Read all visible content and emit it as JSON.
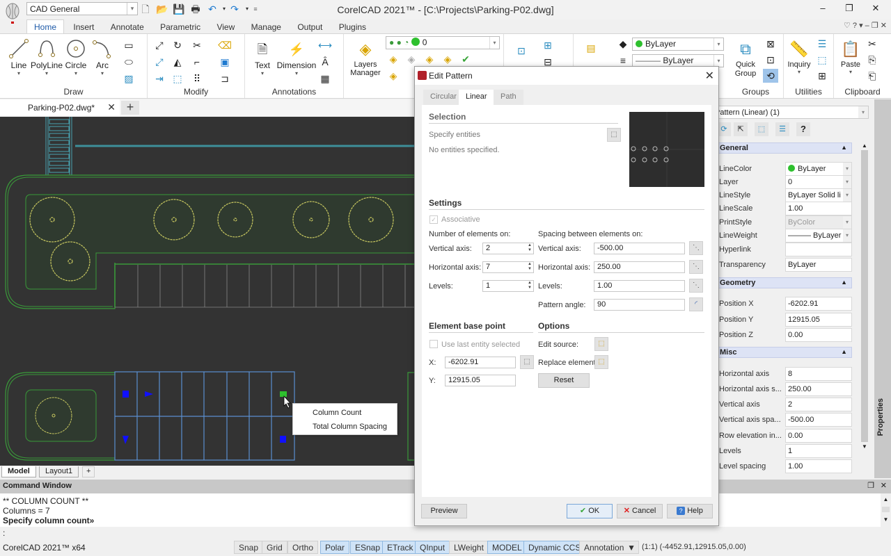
{
  "app": {
    "title": "CorelCAD 2021™ - [C:\\Projects\\Parking-P02.dwg]",
    "workspace": "CAD General",
    "window_controls": {
      "minimize": "‒",
      "restore": "❐",
      "close": "✕"
    },
    "mdi_controls": "♡  ?  ▾  ‒  ❐  ✕"
  },
  "quick_access": [
    {
      "name": "new-file-icon",
      "glyph": "🗋"
    },
    {
      "name": "open-folder-icon",
      "glyph": "📂"
    },
    {
      "name": "save-icon",
      "glyph": "💾"
    },
    {
      "name": "print-icon",
      "glyph": "🖶"
    },
    {
      "name": "undo-icon",
      "glyph": "↶"
    },
    {
      "name": "redo-icon",
      "glyph": "↷"
    }
  ],
  "ribbon_tabs": [
    "Home",
    "Insert",
    "Annotate",
    "Parametric",
    "View",
    "Manage",
    "Output",
    "Plugins"
  ],
  "ribbon": {
    "draw": {
      "label": "Draw",
      "buttons": [
        "Line",
        "PolyLine",
        "Circle",
        "Arc"
      ]
    },
    "modify": {
      "label": "Modify"
    },
    "annotations": {
      "label": "Annotations",
      "buttons": [
        "Text",
        "Dimension"
      ]
    },
    "layers": {
      "button": "Layers Manager",
      "layer_value": "0"
    },
    "properties": {
      "color": "ByLayer",
      "linestyle": "ByLayer"
    },
    "groups": {
      "label": "Groups",
      "button": "Quick Group"
    },
    "utilities": {
      "label": "Utilities",
      "button": "Inquiry"
    },
    "clipboard": {
      "label": "Clipboard",
      "button": "Paste"
    }
  },
  "document_tab": {
    "label": "Parking-P02.dwg*",
    "close": "✕",
    "new": "+"
  },
  "layout_tabs": [
    "Model",
    "Layout1",
    "+"
  ],
  "context_menu": [
    "Column Count",
    "Total Column Spacing"
  ],
  "command_window": {
    "title": "Command Window",
    "lines": [
      "** COLUMN COUNT **",
      "Columns = 7",
      "Specify column count»"
    ],
    "prompt": ":"
  },
  "status_bar": {
    "app": "CorelCAD 2021™ x64",
    "toggles": [
      {
        "label": "Snap",
        "on": false
      },
      {
        "label": "Grid",
        "on": false
      },
      {
        "label": "Ortho",
        "on": false
      },
      {
        "label": "Polar",
        "on": true
      },
      {
        "label": "ESnap",
        "on": true
      },
      {
        "label": "ETrack",
        "on": true
      },
      {
        "label": "QInput",
        "on": true
      },
      {
        "label": "LWeight",
        "on": false
      },
      {
        "label": "MODEL",
        "on": true
      },
      {
        "label": "Dynamic CCS",
        "on": true
      }
    ],
    "annotation": "Annotation",
    "coords": "(1:1)  (-4452.91,12915.05,0.00)"
  },
  "properties_panel": {
    "selector": "Pattern (Linear) (1)",
    "side_label": "Properties",
    "categories": [
      {
        "name": "General",
        "rows": [
          {
            "label": "LineColor",
            "value": "ByLayer",
            "dropdown": true,
            "dot": true
          },
          {
            "label": "Layer",
            "value": "0",
            "dropdown": true
          },
          {
            "label": "LineStyle",
            "value": "ByLayer    Solid li",
            "dropdown": true
          },
          {
            "label": "LineScale",
            "value": "1.00"
          },
          {
            "label": "PrintStyle",
            "value": "ByColor",
            "dropdown": true,
            "disabled": true
          },
          {
            "label": "LineWeight",
            "value": "——— ByLayer",
            "dropdown": true
          },
          {
            "label": "Hyperlink",
            "value": ""
          },
          {
            "label": "Transparency",
            "value": "ByLayer"
          }
        ]
      },
      {
        "name": "Geometry",
        "rows": [
          {
            "label": "Position X",
            "value": "-6202.91"
          },
          {
            "label": "Position Y",
            "value": "12915.05"
          },
          {
            "label": "Position Z",
            "value": "0.00"
          }
        ]
      },
      {
        "name": "Misc",
        "rows": [
          {
            "label": "Horizontal axis",
            "value": "8"
          },
          {
            "label": "Horizontal axis s...",
            "value": "250.00"
          },
          {
            "label": "Vertical axis",
            "value": "2"
          },
          {
            "label": "Vertical axis spa...",
            "value": "-500.00"
          },
          {
            "label": "Row elevation in...",
            "value": "0.00"
          },
          {
            "label": "Levels",
            "value": "1"
          },
          {
            "label": "Level spacing",
            "value": "1.00"
          }
        ]
      }
    ]
  },
  "dialog": {
    "title": "Edit Pattern",
    "tabs": [
      "Circular",
      "Linear",
      "Path"
    ],
    "active_tab": "Linear",
    "selection": {
      "heading": "Selection",
      "specify": "Specify entities",
      "status": "No entities specified."
    },
    "settings": {
      "heading": "Settings",
      "associative": "Associative",
      "number_heading": "Number of elements on:",
      "spacing_heading": "Spacing between elements on:",
      "vertical_label": "Vertical axis:",
      "horizontal_label": "Horizontal axis:",
      "levels_label": "Levels:",
      "angle_label": "Pattern angle:",
      "num_vertical": "2",
      "num_horizontal": "7",
      "num_levels": "1",
      "sp_vertical": "-500.00",
      "sp_horizontal": "250.00",
      "sp_levels": "1.00",
      "angle": "90"
    },
    "base_point": {
      "heading": "Element base point",
      "use_last": "Use last entity selected",
      "x_label": "X:",
      "y_label": "Y:",
      "x": "-6202.91",
      "y": "12915.05"
    },
    "options": {
      "heading": "Options",
      "edit_source": "Edit source:",
      "replace": "Replace element:",
      "reset": "Reset"
    },
    "buttons": {
      "preview": "Preview",
      "ok": "OK",
      "cancel": "Cancel",
      "help": "Help"
    }
  }
}
